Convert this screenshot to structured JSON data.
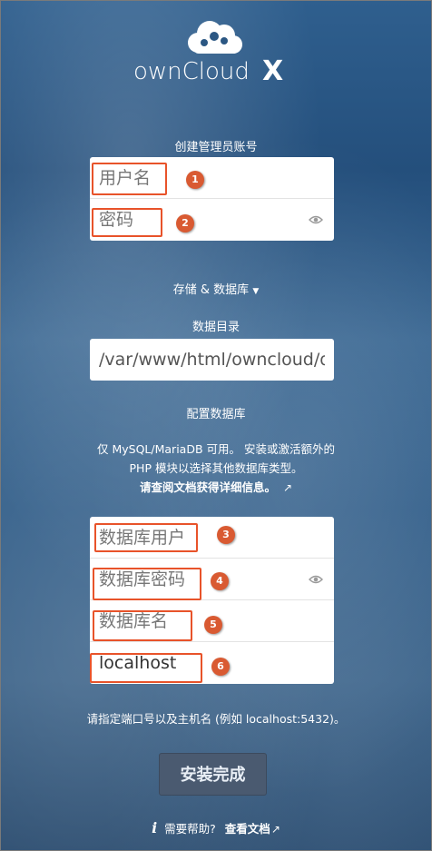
{
  "logo": {
    "text": "ownCloud",
    "mark": "X"
  },
  "admin": {
    "heading": "创建管理员账号",
    "username_placeholder": "用户名",
    "password_placeholder": "密码"
  },
  "storage": {
    "toggle_label": "存储 & 数据库",
    "datadir_label": "数据目录",
    "datadir_value": "/var/www/html/owncloud/data"
  },
  "database": {
    "heading": "配置数据库",
    "info_line1": "仅 MySQL/MariaDB 可用。 安装或激活额外的",
    "info_line2": "PHP 模块以选择其他数据库类型。",
    "info_link": "请查阅文档获得详细信息。",
    "db_user_placeholder": "数据库用户",
    "db_password_placeholder": "数据库密码",
    "db_name_placeholder": "数据库名",
    "db_host_value": "localhost",
    "host_hint": "请指定端口号以及主机名 (例如 localhost:5432)。"
  },
  "install_button": "安装完成",
  "help": {
    "text": "需要帮助?",
    "link": "查看文档"
  },
  "markers": [
    "1",
    "2",
    "3",
    "4",
    "5",
    "6"
  ],
  "colors": {
    "marker": "#d95a32",
    "highlight": "#e8532a",
    "button": "#4a5a70"
  }
}
